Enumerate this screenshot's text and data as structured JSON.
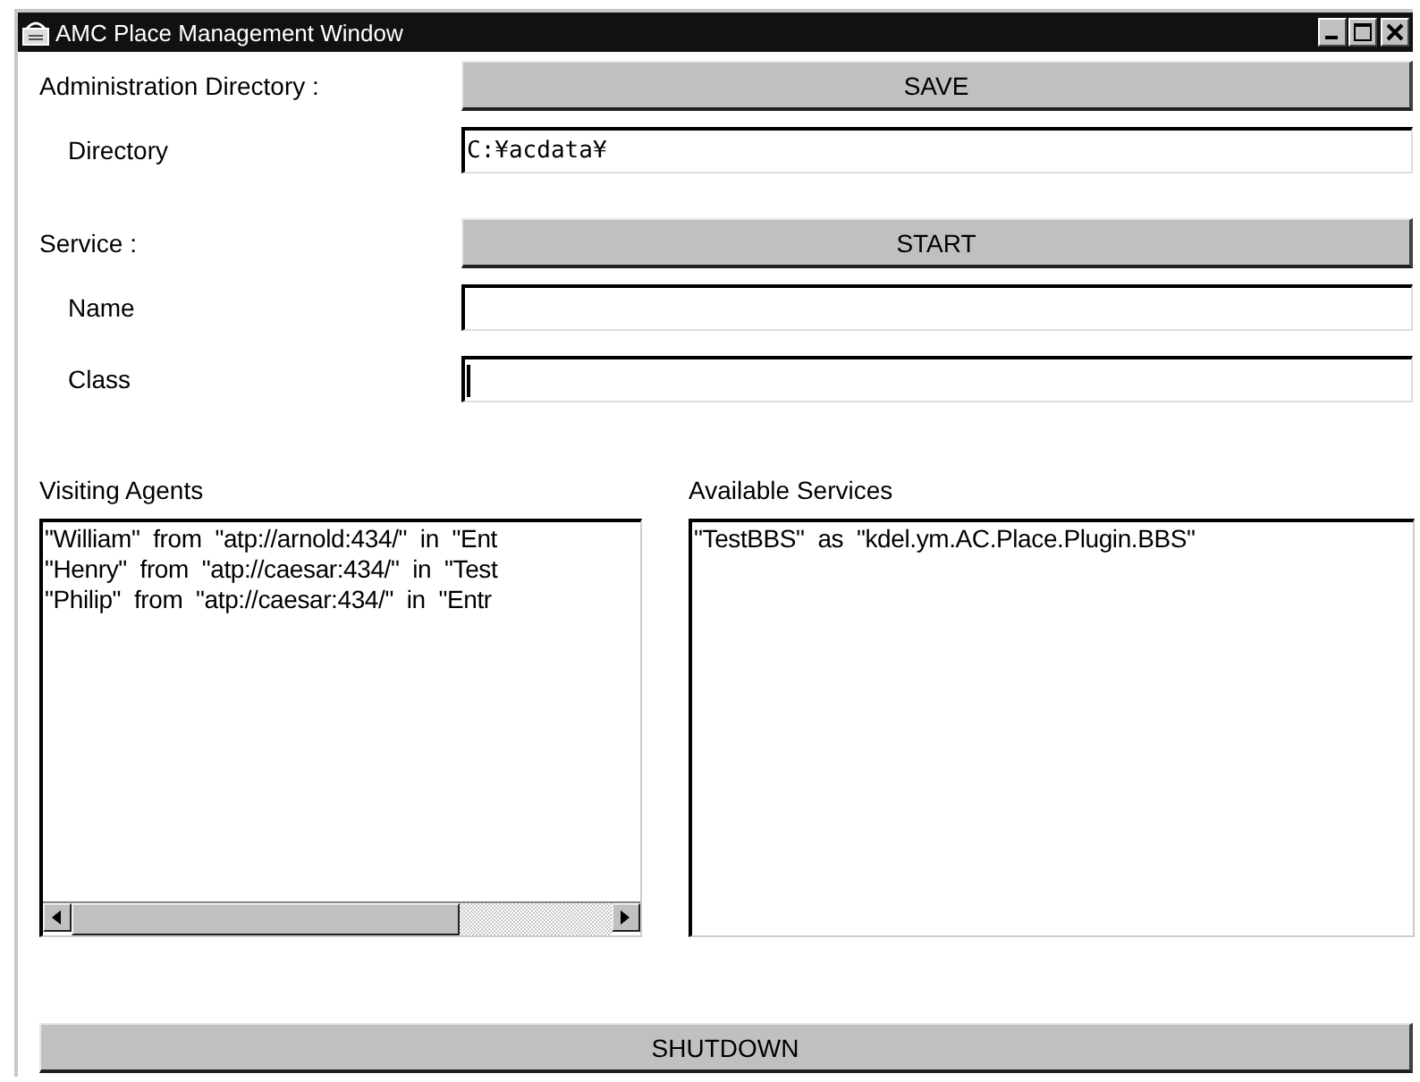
{
  "window": {
    "title": "AMC Place Management Window"
  },
  "administration": {
    "label": "Administration Directory :",
    "button": "SAVE",
    "fields": [
      {
        "label": "Directory",
        "value": "C:¥acdata¥",
        "focused": false
      }
    ]
  },
  "service": {
    "label": "Service :",
    "button": "START",
    "fields": [
      {
        "label": "Name",
        "focused": false
      },
      {
        "label": "Class",
        "focused": true
      }
    ]
  },
  "visiting_agents": {
    "label": "Visiting Agents",
    "items": [
      "\"William\"  from  \"atp://arnold:434/\"  in  \"Ent",
      "\"Henry\"  from  \"atp://caesar:434/\"  in  \"Test",
      "\"Philip\"  from  \"atp://caesar:434/\"  in  \"Entr"
    ]
  },
  "available_services": {
    "label": "Available Services",
    "items": [
      "\"TestBBS\"  as  \"kdel.ym.AC.Place.Plugin.BBS\""
    ]
  },
  "shutdown_button": "SHUTDOWN"
}
